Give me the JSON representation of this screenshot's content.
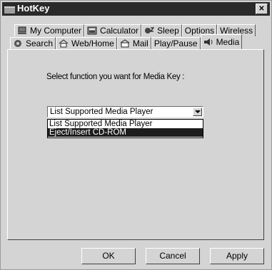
{
  "window": {
    "title": "HotKey",
    "close_symbol": "✕"
  },
  "tabs_row1": [
    {
      "label": "My Computer",
      "icon": "computer-icon"
    },
    {
      "label": "Calculator",
      "icon": "calculator-icon"
    },
    {
      "label": "Sleep",
      "icon": "sleep-icon"
    },
    {
      "label": "Options",
      "icon": ""
    },
    {
      "label": "Wireless",
      "icon": ""
    }
  ],
  "tabs_row2": [
    {
      "label": "Search",
      "icon": "search-icon"
    },
    {
      "label": "Web/Home",
      "icon": "home-icon"
    },
    {
      "label": "Mail",
      "icon": "mail-icon"
    },
    {
      "label": "Play/Pause",
      "icon": ""
    },
    {
      "label": "Media",
      "icon": "media-icon",
      "active": true
    }
  ],
  "media_panel": {
    "prompt": "Select function you want for Media Key :",
    "select": {
      "value": "List Supported Media Player",
      "options": [
        "List Supported Media Player",
        "Eject/Insert CD-ROM"
      ],
      "highlighted_option": "Eject/Insert CD-ROM"
    }
  },
  "buttons": {
    "ok": "OK",
    "cancel": "Cancel",
    "apply": "Apply"
  }
}
